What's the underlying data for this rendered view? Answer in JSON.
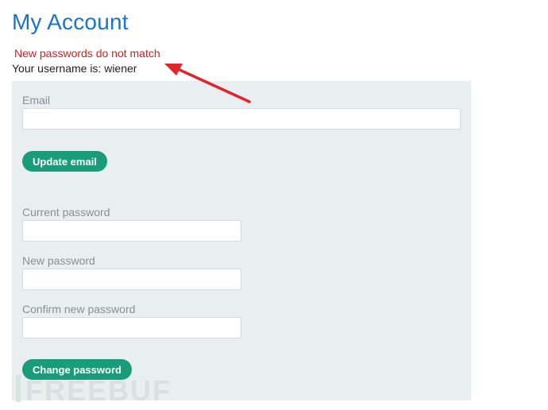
{
  "page": {
    "title": "My Account",
    "error_message": "New passwords do not match",
    "username_text": "Your username is: wiener"
  },
  "email_form": {
    "label": "Email",
    "value": "",
    "button_label": "Update email"
  },
  "password_form": {
    "current_label": "Current password",
    "current_value": "",
    "new_label": "New password",
    "new_value": "",
    "confirm_label": "Confirm new password",
    "confirm_value": "",
    "button_label": "Change password"
  },
  "annotation": {
    "arrow_color": "#e0262a"
  },
  "watermark": {
    "text": "FREEBUF"
  },
  "colors": {
    "title": "#1b74c5",
    "error": "#d21f1f",
    "button": "#1a9c7b",
    "panel": "#e9eef0"
  }
}
